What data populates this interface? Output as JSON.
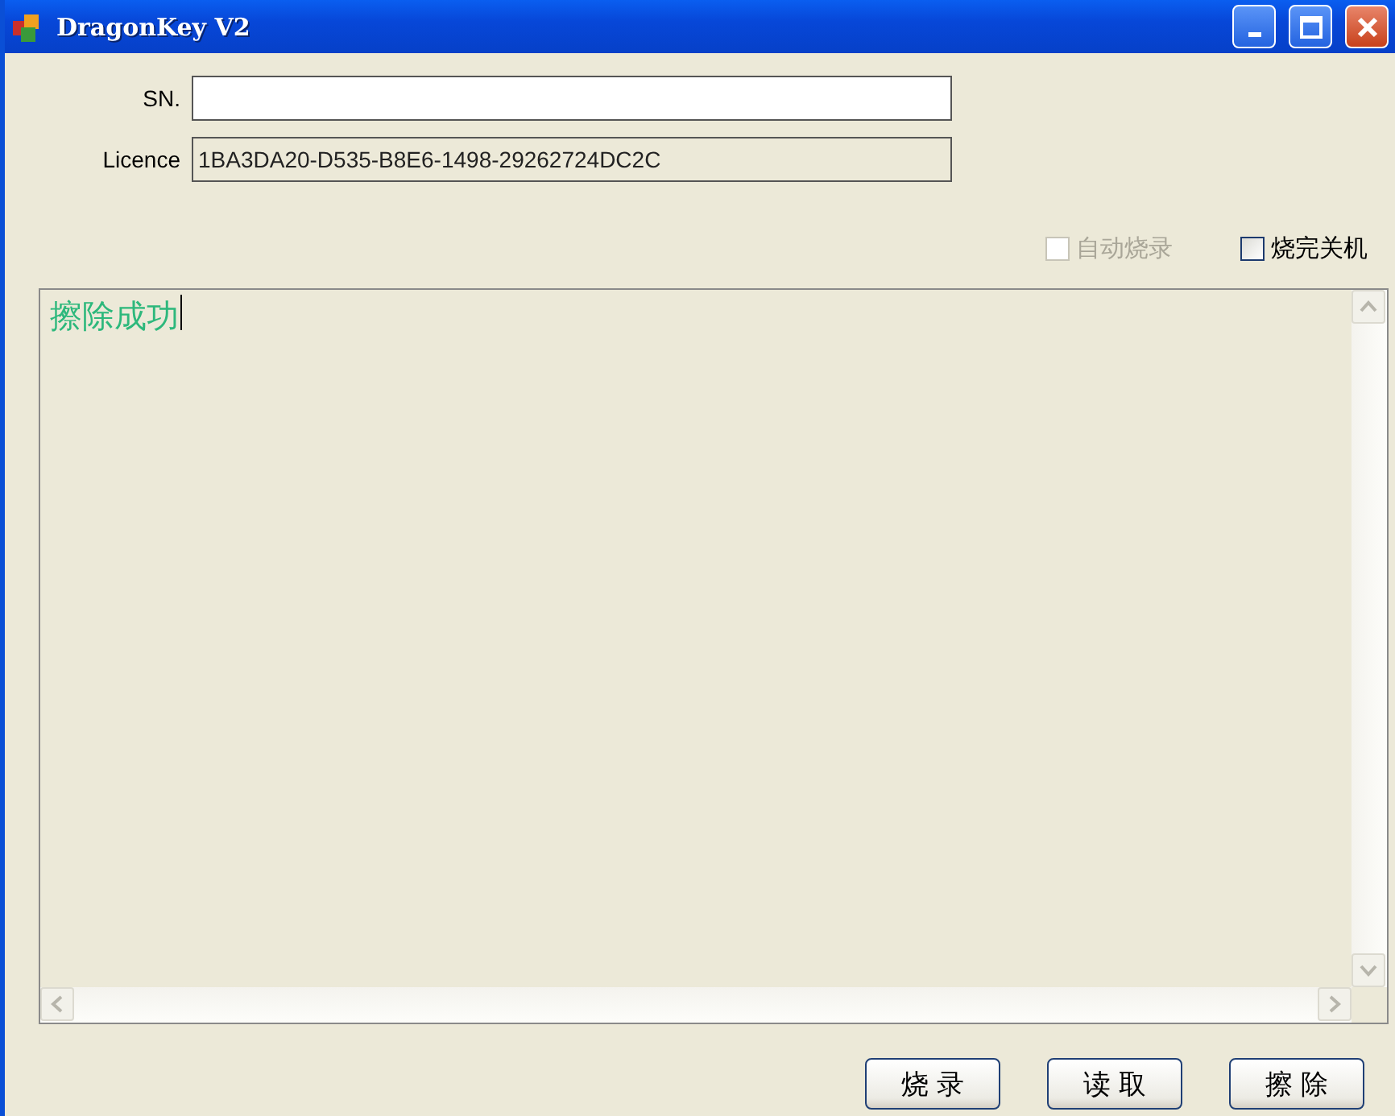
{
  "window": {
    "title": "DragonKey V2"
  },
  "fields": [
    {
      "label": "SN.",
      "disabled": false
    },
    {
      "label": "Licence",
      "value": "1BA3DA20-D535-B8E6-1498-29262724DC2C",
      "disabled": true
    }
  ],
  "options": [
    {
      "label": "自动烧录",
      "checked": false,
      "disabled": true
    },
    {
      "label": "烧完关机",
      "checked": false,
      "disabled": false
    }
  ],
  "log": {
    "text": "擦除成功"
  },
  "buttons": [
    "烧 录",
    "读 取",
    "擦 除"
  ]
}
